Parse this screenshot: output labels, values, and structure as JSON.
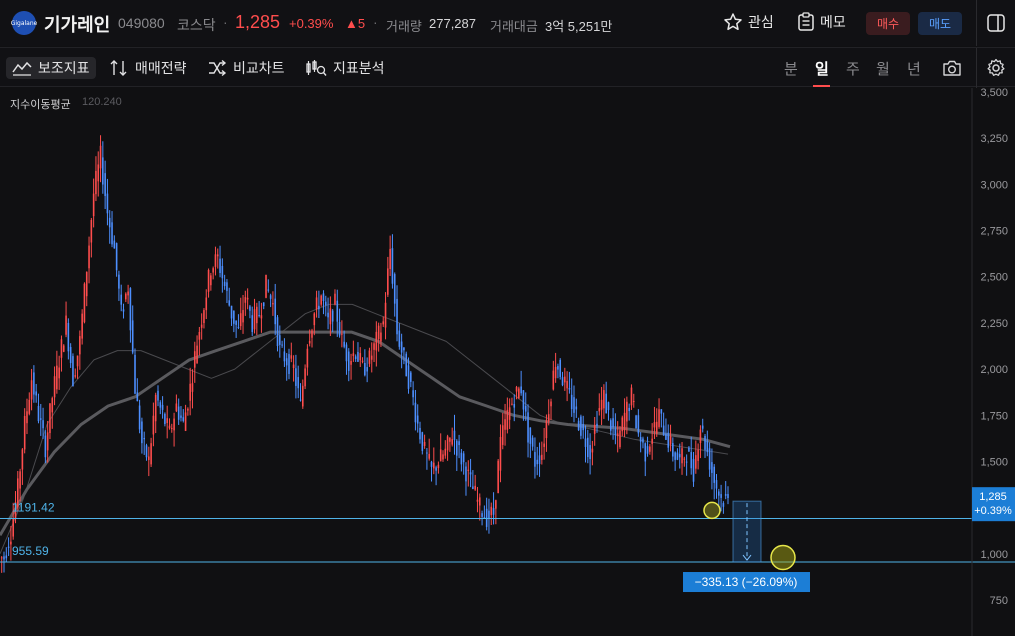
{
  "header": {
    "logo_text": "Gigalane",
    "name": "기가레인",
    "code": "049080",
    "market": "코스닥",
    "price": "1,285",
    "change_pct": "+0.39%",
    "change_abs": "▲5",
    "volume_label": "거래량",
    "volume": "277,287",
    "amount_label": "거래대금",
    "amount": "3억 5,251만",
    "fav_label": "관심",
    "memo_label": "메모",
    "buy_label": "매수",
    "sell_label": "매도"
  },
  "toolbar": {
    "indicator_label": "보조지표",
    "strategy_label": "매매전략",
    "compare_label": "비교차트",
    "analysis_label": "지표분석",
    "periods": [
      "분",
      "일",
      "주",
      "월",
      "년"
    ],
    "selected_period": "일"
  },
  "indicator": {
    "name": "지수이동평균",
    "value": "120.240"
  },
  "colors": {
    "up": "#ff4d4d",
    "down": "#4d8fff",
    "accent": "#1c7ed6",
    "level_line": "#4fb3e8"
  },
  "chart_data": {
    "type": "line",
    "title": "",
    "ylabel": "",
    "ylim": [
      700,
      3500
    ],
    "yticks": [
      "3,500",
      "3,250",
      "3,000",
      "2,750",
      "2,500",
      "2,250",
      "2,000",
      "1,750",
      "1,500",
      "1,250",
      "1,000",
      "750"
    ],
    "ytick_values": [
      3500,
      3250,
      3000,
      2750,
      2500,
      2250,
      2000,
      1750,
      1500,
      1250,
      1000,
      750
    ],
    "series": [
      {
        "style": "up/down candles",
        "values": [
          980,
          1120,
          1350,
          1700,
          1950,
          1750,
          1580,
          1850,
          2050,
          2250,
          1950,
          2150,
          2550,
          2950,
          3150,
          2850,
          2650,
          2300,
          2450,
          1900,
          1600,
          1500,
          1850,
          1750,
          1650,
          1800,
          1700,
          1900,
          2150,
          2350,
          2550,
          2600,
          2450,
          2300,
          2200,
          2400,
          2250,
          2300,
          2450,
          2350,
          2100,
          2050,
          2000,
          1800,
          2150,
          2300,
          2400,
          2250,
          2350,
          2150,
          2050,
          2100,
          2000,
          2050,
          2150,
          2250,
          2650,
          2200,
          2050,
          1900,
          1700,
          1550,
          1450,
          1500,
          1550,
          1650,
          1550,
          1450,
          1350,
          1250,
          1200,
          1220,
          1600,
          1750,
          1850,
          1900,
          1650,
          1500,
          1550,
          1800,
          2050,
          1950,
          1850,
          1750,
          1650,
          1550,
          1750,
          1850,
          1700,
          1600,
          1750,
          1850,
          1650,
          1550,
          1650,
          1750,
          1650,
          1550,
          1500,
          1550,
          1450,
          1700,
          1550,
          1400,
          1300,
          1285
        ]
      },
      {
        "style": "ema-short",
        "values": [
          1000,
          1300,
          1700,
          1900,
          2050,
          2100,
          2100,
          2050,
          2000,
          1950,
          2000,
          2100,
          2200,
          2300,
          2350,
          2350,
          2300,
          2250,
          2200,
          2150,
          2050,
          1950,
          1850,
          1750,
          1700,
          1680,
          1650,
          1620,
          1600,
          1580,
          1560,
          1540
        ]
      },
      {
        "style": "ema-long",
        "values": [
          1100,
          1350,
          1550,
          1700,
          1800,
          1850,
          1950,
          2050,
          2100,
          2150,
          2200,
          2200,
          2200,
          2200,
          2150,
          2050,
          1950,
          1850,
          1800,
          1750,
          1720,
          1700,
          1690,
          1680,
          1660,
          1640,
          1620,
          1580
        ]
      }
    ],
    "price_tag": {
      "label": "1,285",
      "sublabel": "+0.39%",
      "value": 1285
    },
    "levels": [
      {
        "label": "1191.42",
        "value": 1191.42
      },
      {
        "label": "955.59",
        "value": 955.59
      }
    ],
    "measure": {
      "label": "−335.13 (−26.09%)",
      "from": 1285,
      "to": 955.59
    }
  }
}
